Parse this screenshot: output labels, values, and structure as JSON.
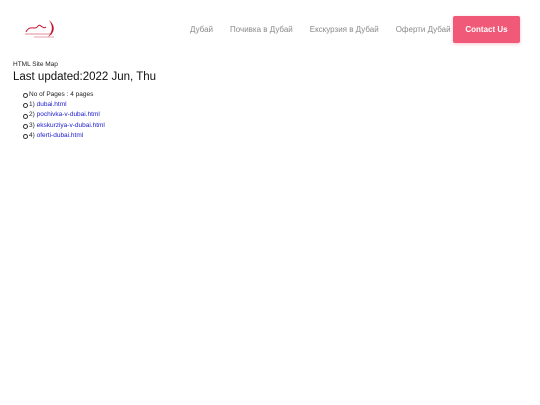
{
  "header": {
    "logo_text": "Madgirl",
    "nav": [
      {
        "label": "Дубай"
      },
      {
        "label": "Почивка в Дубай"
      },
      {
        "label": "Екскурзия в Дубай"
      },
      {
        "label": "Оферти Дубай"
      }
    ],
    "contact_label": "Contact Us",
    "accent_color": "#f05a78"
  },
  "content": {
    "breadcrumb": "HTML Site Map",
    "updated_label": "Last updated:",
    "updated_value": "2022 Jun, Thu",
    "pages_count": "No of Pages : 4 pages",
    "links": [
      {
        "num": "1)",
        "href": "dubai.html"
      },
      {
        "num": "2)",
        "href": "pochivka-v-dubai.html"
      },
      {
        "num": "3)",
        "href": "ekskurziya-v-dubai.html"
      },
      {
        "num": "4)",
        "href": "oferti-dubai.html"
      }
    ]
  }
}
